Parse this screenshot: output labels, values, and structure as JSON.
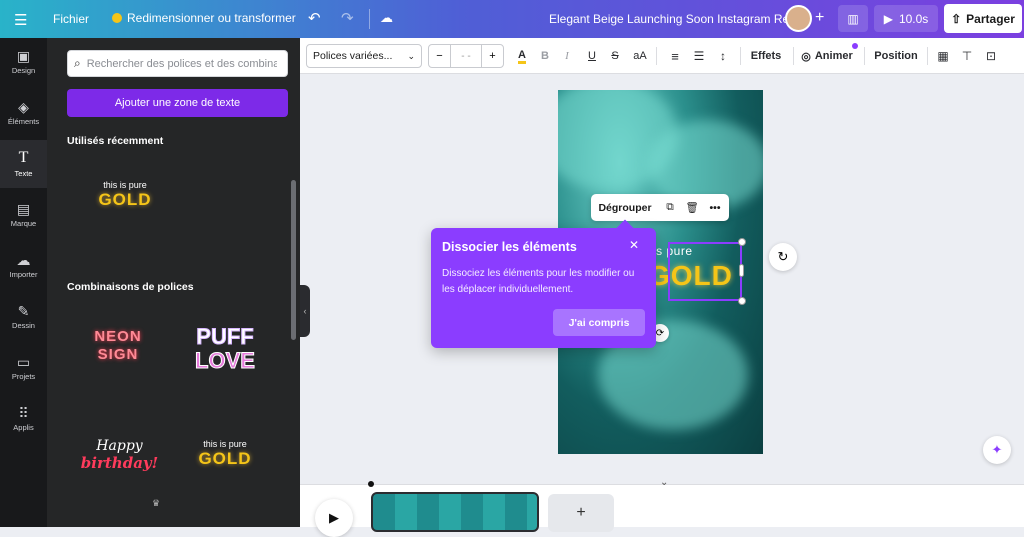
{
  "topbar": {
    "menu_icon": "hamburger-icon",
    "file_label": "Fichier",
    "resize_label": "Redimensionner ou transformer",
    "project_title": "Elegant Beige Launching Soon Instagram Reel",
    "duration": "10.0s",
    "share_label": "Partager"
  },
  "leftnav": {
    "items": [
      {
        "label": "Design",
        "icon": "layout-icon"
      },
      {
        "label": "Éléments",
        "icon": "shapes-icon"
      },
      {
        "label": "Texte",
        "icon": "text-icon"
      },
      {
        "label": "Marque",
        "icon": "brand-icon"
      },
      {
        "label": "Importer",
        "icon": "cloud-upload-icon"
      },
      {
        "label": "Dessin",
        "icon": "pen-icon"
      },
      {
        "label": "Projets",
        "icon": "folder-icon"
      },
      {
        "label": "Applis",
        "icon": "apps-grid-icon"
      }
    ]
  },
  "panel": {
    "search_placeholder": "Rechercher des polices et des combinaisons",
    "add_text_label": "Ajouter une zone de texte",
    "recent_title": "Utilisés récemment",
    "combos_title": "Combinaisons de polices",
    "gold_small": "this is pure",
    "gold_big": "GOLD",
    "neon_text": "NEON SIGN",
    "puff_text_1": "PUFF",
    "puff_text_2": "LOVE",
    "happy_text_1": "Happy",
    "happy_text_2": "birthday!"
  },
  "toolbar": {
    "font_name": "Polices variées...",
    "font_size": "- -",
    "effects_label": "Effets",
    "animate_label": "Animer",
    "position_label": "Position"
  },
  "context_menu": {
    "ungroup_label": "Dégrouper"
  },
  "canvas": {
    "text_small": "is pure",
    "text_big": "GOLD"
  },
  "tooltip": {
    "title": "Dissocier les éléments",
    "body": "Dissociez les éléments pour les modifier ou les déplacer individuellement.",
    "ok_label": "J'ai compris"
  },
  "colors": {
    "accent": "#8b3dff",
    "button_purple": "#7d2ae8",
    "gold": "#f5c518",
    "neon_red": "#ff5a6a"
  }
}
